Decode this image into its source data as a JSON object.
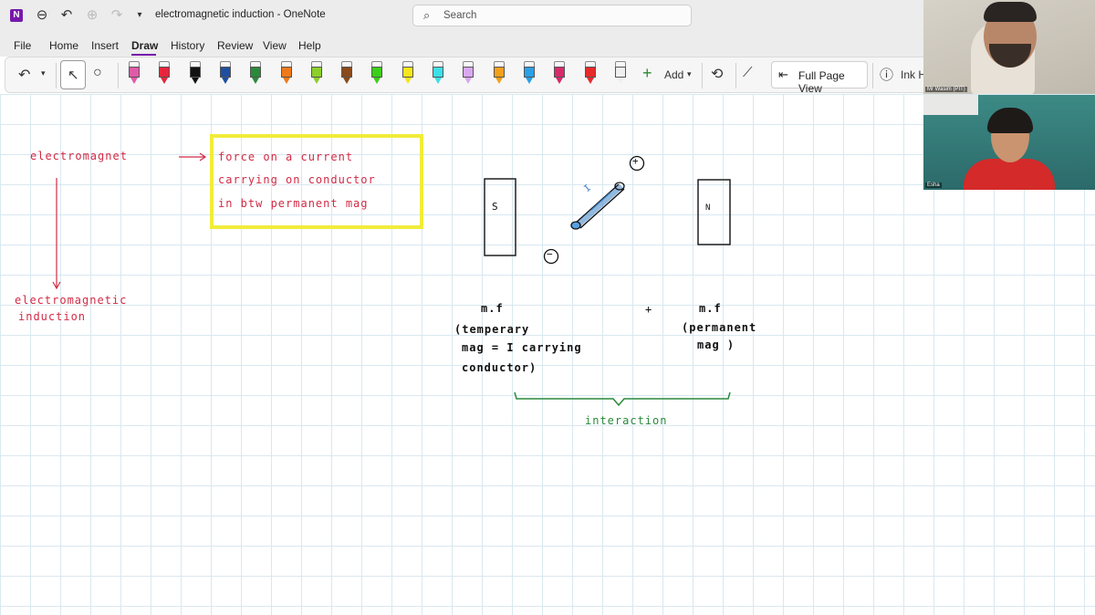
{
  "titlebar": {
    "app_letter": "N",
    "title": "electromagnetic induction  -  OneNote",
    "search_placeholder": "Search"
  },
  "menu": [
    "File",
    "Home",
    "Insert",
    "Draw",
    "History",
    "Review",
    "View",
    "Help"
  ],
  "ribbon": {
    "add_label": "Add",
    "full_page_view": "Full Page View",
    "ink_help": "Ink H",
    "pen_colors": [
      "#e05aa8",
      "#e8243c",
      "#111111",
      "#1f4fa0",
      "#2a8a3a",
      "#f07a1a",
      "#8ccf2a",
      "#8a4a1a",
      "#3ccf1a",
      "#f5e61a",
      "#3ce0e8",
      "#d9a8f0",
      "#f5a01a",
      "#2aa0e8",
      "#d82a6a",
      "#e82a2a",
      "#f0f0f0"
    ]
  },
  "notes": {
    "electromagnet": "electromagnet",
    "box_line1": "force on a current",
    "box_line2": "carrying on conductor",
    "box_line3": "in btw permanent mag",
    "induction_line1": "electromagnetic",
    "induction_line2": "induction",
    "magnet_s": "S",
    "magnet_n": "N",
    "plus": "+",
    "minus": "−",
    "wire_label": "I",
    "mf_left": "m.f",
    "mf_right": "m.f",
    "plus_sign": "+",
    "temp_line1": "(temperary",
    "temp_line2": "mag = I carrying",
    "temp_line3": "conductor)",
    "perm_line1": "(permanent",
    "perm_line2": "mag )",
    "interaction": "interaction"
  },
  "participants": {
    "p1_name": "Mr Wasim (PIT)",
    "p2_name": "Esha"
  }
}
